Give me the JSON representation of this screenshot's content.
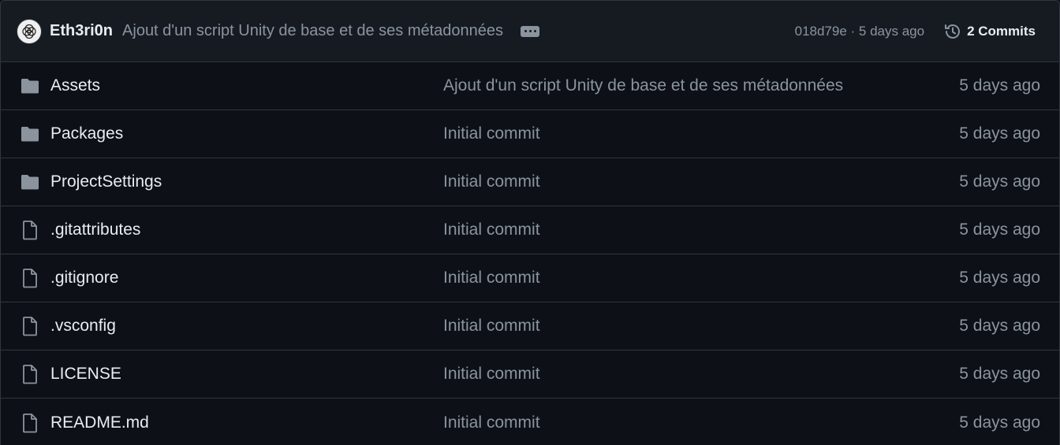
{
  "latest_commit": {
    "author": "Eth3ri0n",
    "message": "Ajout d'un script Unity de base et de ses métadonnées",
    "sha_and_time": "018d79e · 5 days ago",
    "commits_label": "2 Commits",
    "avatar_icon": "avatar-circles-icon",
    "history_icon": "history-clock-icon"
  },
  "colors": {
    "background": "#0d1117",
    "header_bg": "#161b22",
    "border": "#30363d",
    "text_primary": "#e6edf3",
    "text_muted": "#8b949e",
    "icon_gray": "#8b949e"
  },
  "files": [
    {
      "name": "Assets",
      "type": "folder",
      "icon": "folder-icon",
      "message": "Ajout d'un script Unity de base et de ses métadonnées",
      "age": "5 days ago"
    },
    {
      "name": "Packages",
      "type": "folder",
      "icon": "folder-icon",
      "message": "Initial commit",
      "age": "5 days ago"
    },
    {
      "name": "ProjectSettings",
      "type": "folder",
      "icon": "folder-icon",
      "message": "Initial commit",
      "age": "5 days ago"
    },
    {
      "name": ".gitattributes",
      "type": "file",
      "icon": "file-icon",
      "message": "Initial commit",
      "age": "5 days ago"
    },
    {
      "name": ".gitignore",
      "type": "file",
      "icon": "file-icon",
      "message": "Initial commit",
      "age": "5 days ago"
    },
    {
      "name": ".vsconfig",
      "type": "file",
      "icon": "file-icon",
      "message": "Initial commit",
      "age": "5 days ago"
    },
    {
      "name": "LICENSE",
      "type": "file",
      "icon": "file-icon",
      "message": "Initial commit",
      "age": "5 days ago"
    },
    {
      "name": "README.md",
      "type": "file",
      "icon": "file-icon",
      "message": "Initial commit",
      "age": "5 days ago"
    }
  ]
}
